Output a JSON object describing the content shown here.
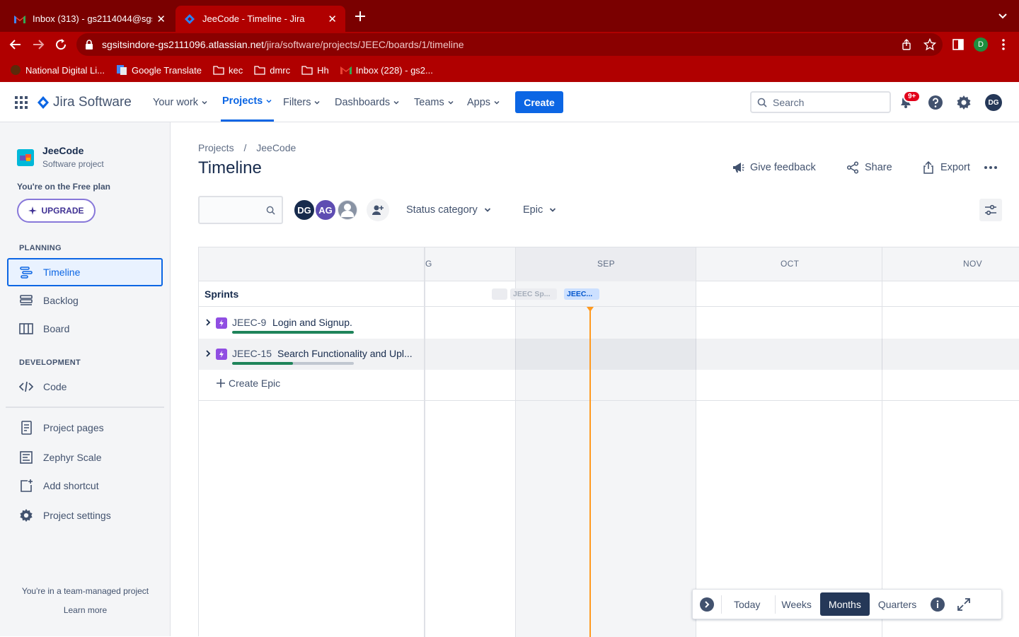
{
  "browser": {
    "tabs": [
      {
        "title": "Inbox (313) - gs2114044@sgsi",
        "active": false
      },
      {
        "title": "JeeCode - Timeline - Jira",
        "active": true
      }
    ],
    "url_domain": "sgsitsindore-gs2111096.atlassian.net",
    "url_path": "/jira/software/projects/JEEC/boards/1/timeline",
    "profile_initial": "D",
    "bookmarks": [
      {
        "label": "National Digital Li..."
      },
      {
        "label": "Google Translate"
      },
      {
        "label": "kec"
      },
      {
        "label": "dmrc"
      },
      {
        "label": "Hh"
      },
      {
        "label": "Inbox (228) - gs2..."
      }
    ]
  },
  "topnav": {
    "product": "Jira Software",
    "items": [
      "Your work",
      "Projects",
      "Filters",
      "Dashboards",
      "Teams",
      "Apps"
    ],
    "create_label": "Create",
    "search_placeholder": "Search",
    "notification_badge": "9+",
    "avatar_initials": "DG"
  },
  "sidebar": {
    "project_name": "JeeCode",
    "project_type": "Software project",
    "plan_text": "You're on the Free plan",
    "upgrade_label": "UPGRADE",
    "planning_heading": "PLANNING",
    "planning_items": [
      "Timeline",
      "Backlog",
      "Board"
    ],
    "development_heading": "DEVELOPMENT",
    "development_items": [
      "Code"
    ],
    "other_items": [
      "Project pages",
      "Zephyr Scale",
      "Add shortcut",
      "Project settings"
    ],
    "team_managed_text": "You're in a team-managed project",
    "learn_more": "Learn more"
  },
  "main": {
    "breadcrumb": [
      "Projects",
      "JeeCode"
    ],
    "breadcrumb_sep": "/",
    "title": "Timeline",
    "actions": {
      "feedback": "Give feedback",
      "share": "Share",
      "export": "Export"
    },
    "avatars": [
      {
        "initials": "DG",
        "color": "#172b4d"
      },
      {
        "initials": "AG",
        "color": "#5e4db2"
      }
    ],
    "filters": {
      "status_category": "Status category",
      "epic": "Epic"
    }
  },
  "timeline": {
    "months": [
      "G",
      "SEP",
      "OCT",
      "NOV"
    ],
    "sprints_label": "Sprints",
    "sprints": [
      {
        "label": "JEEC Sp...",
        "state": "past"
      },
      {
        "label": "JEEC...",
        "state": "active"
      }
    ],
    "epics": [
      {
        "key": "JEEC-9",
        "summary": "Login and Signup.",
        "progress_done": 1.0
      },
      {
        "key": "JEEC-15",
        "summary": "Search Functionality and Upl...",
        "progress_done": 0.5
      }
    ],
    "create_epic_label": "Create Epic",
    "today_color": "#ff991f"
  },
  "zoom_bar": {
    "buttons": [
      "Today",
      "Weeks",
      "Months",
      "Quarters"
    ],
    "selected": "Months"
  }
}
